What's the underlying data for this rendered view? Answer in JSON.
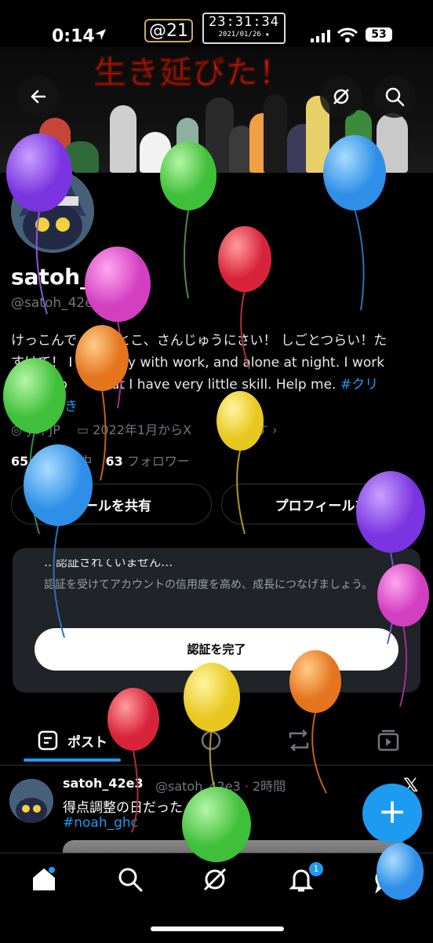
{
  "status_bar": {
    "time": "0:14",
    "badge_count": "@21",
    "clock_big": "23:31:34",
    "clock_small": "2021/01/26 ★",
    "battery": "53"
  },
  "banner": {
    "title": "生き延びた！"
  },
  "profile": {
    "name": "satoh_",
    "handle": "@satoh_42e",
    "bio_line1": "けっこんで　　おとこ、さんじゅうにさい！ しごとつらい！た",
    "bio_line2": "すけて！ I　　　usy with work, and alone at night. I work",
    "bio_line3": "　　　eo　　, but I have very little skill. Help me.",
    "bio_tag": "#クリ",
    "bio_line4": "きーさすき",
    "location": "yo, JP",
    "joined": "2022年1月からX",
    "joined_tail": "ています",
    "following_count": "65",
    "following_label": "中",
    "followers_count": "63",
    "followers_label": "フォロワー",
    "share_button": "ィールを共有",
    "edit_button": "プロフィールを"
  },
  "verify_card": {
    "cut_title": "…認証されていません…",
    "description": "認証を受けてアカウントの信用度を高め、成長につなげましょう。",
    "button": "認証を完了"
  },
  "tabs": {
    "posts_label": "ポスト"
  },
  "post": {
    "name": "satoh_42e3",
    "meta": "@satoh_42e3 · 2時間",
    "text": "得点調整の日だった",
    "tag": "#noah_ghc"
  },
  "nav": {
    "notification_count": "1"
  },
  "colors": {
    "accent": "#1d9bf0",
    "banner_title": "#d42a1a"
  },
  "icons": [
    "location-arrow-icon",
    "back-arrow-icon",
    "grok-icon",
    "search-icon",
    "more-icon",
    "calendar-icon",
    "x-logo-icon",
    "compose-plus-icon",
    "home-icon",
    "notifications-bell-icon",
    "messages-icon",
    "posts-tab-icon",
    "reposts-icon",
    "media-tab-icon",
    "replies-icon"
  ]
}
